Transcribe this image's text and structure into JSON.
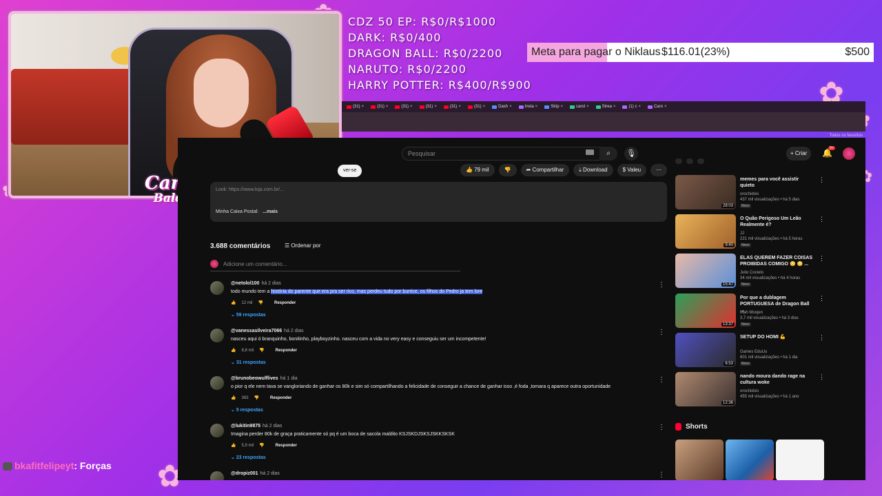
{
  "goals": {
    "lines": [
      "CDZ 50 EP: R$0/R$1000",
      "DARK: R$0/400",
      "DRAGON BALL: R$0/2200",
      "NARUTO: R$0/2200",
      "HARRY POTTER: R$400/R$900"
    ],
    "bar": {
      "title": "Meta para pagar o Niklaus",
      "current": "$116.01(23%)",
      "target": "$500",
      "progress": 0.23
    }
  },
  "stream": {
    "logo_line1": "Carol",
    "logo_line2": "Balds"
  },
  "browser": {
    "tabs": [
      {
        "label": "(31)",
        "icon": "youtube-icon"
      },
      {
        "label": "(31)",
        "icon": "youtube-icon"
      },
      {
        "label": "(31)",
        "icon": "youtube-icon"
      },
      {
        "label": "(31)",
        "icon": "youtube-icon"
      },
      {
        "label": "(31)",
        "icon": "youtube-icon"
      },
      {
        "label": "(31)",
        "icon": "youtube-icon"
      },
      {
        "label": "Dash",
        "icon": "dashboard-icon"
      },
      {
        "label": "Insta",
        "icon": "instagram-icon"
      },
      {
        "label": "Strip",
        "icon": "stripe-icon"
      },
      {
        "label": "carol",
        "icon": "kick-icon"
      },
      {
        "label": "Strea",
        "icon": "kick-icon"
      },
      {
        "label": "(1) c",
        "icon": "tab-icon"
      },
      {
        "label": "Caro",
        "icon": "tab-icon"
      }
    ],
    "bookmark_label": "Todos os favoritos"
  },
  "youtube": {
    "search_placeholder": "Pesquisar",
    "create_label": "Criar",
    "notification_count": "9+",
    "subscribe_label": "ver-se",
    "actions": {
      "likes": "79 mil",
      "share": "Compartilhar",
      "download": "Download",
      "thanks": "Valeu"
    },
    "description": {
      "line1": "Look: https://www.loja.com.br/...",
      "line2": "Minha Caixa Postal:",
      "more": "...mais"
    },
    "comments_header": {
      "count": "3.688 comentários",
      "sort": "Ordenar por",
      "add_placeholder": "Adicione um comentário..."
    },
    "comments": [
      {
        "author": "@netolol100",
        "age": "há 2 dias",
        "text_plain": "todo mundo tem a ",
        "text_highlight": "história do parente que era pra ser rico, mas perdeu tudo por burrice, os filhos do Pedro ja tem lore",
        "likes": "12 mil",
        "reply": "Responder",
        "replies": "59 respostas"
      },
      {
        "author": "@vanessasilveira7066",
        "age": "há 2 dias",
        "text_plain": "nasceu aqui ó branquinho, bonitinho, playboyzinho. nasceu com a vida no very easy e conseguiu ser um incompetente!",
        "text_highlight": "",
        "likes": "8,8 mil",
        "reply": "Responder",
        "replies": "31 respostas"
      },
      {
        "author": "@brunobeowulflives",
        "age": "há 1 dia",
        "text_plain": "o pior q ele nem tava se vangloriando de ganhar os 80k e sim só compartilhando a felicidade de conseguir a chance de ganhar isso ,é foda ,tomara q aparece outra oportunidade",
        "text_highlight": "",
        "likes": "363",
        "reply": "Responder",
        "replies": "5 respostas"
      },
      {
        "author": "@lukitin9875",
        "age": "há 2 dias",
        "text_plain": "Imagina perder 80k de graça praticamente só pq é um boca de sacola maldito KSJSKDJSKSJSKKSKSK",
        "text_highlight": "",
        "likes": "5,9 mil",
        "reply": "Responder",
        "replies": "23 respostas"
      },
      {
        "author": "@dropiz001",
        "age": "há 2 dias",
        "text_plain": "",
        "text_highlight": "",
        "likes": "",
        "reply": "",
        "replies": ""
      }
    ],
    "recommendations": [
      {
        "title": "memes para você assistir quieto",
        "channel": "orochidois",
        "views": "437 mil visualizações • há 5 dias",
        "duration": "28:03",
        "badge": "Novo"
      },
      {
        "title": "O Quão Perigoso Um Leão Realmente é?",
        "channel": "JJ",
        "views": "221 mil visualizações • há 5 horas",
        "duration": "9:40",
        "badge": "Novo"
      },
      {
        "title": "ELAS QUEREM FAZER COISAS PROIBIDAS COMIGO 😳 😳 ...",
        "channel": "Julio Cocielo",
        "views": "34 mil visualizações • há 4 horas",
        "duration": "15:47",
        "badge": "Novo"
      },
      {
        "title": "Por que a dublagem PORTUGUESA de Dragon Ball ...",
        "channel": "Mah Moojen",
        "views": "3,7 mil visualizações • há 3 dias",
        "duration": "13:37",
        "badge": "Novo"
      },
      {
        "title": "SETUP DO HOMI 💪",
        "channel": "Games EduUu",
        "views": "601 mil visualizações • há 1 dia",
        "duration": "6:53",
        "badge": "Novo"
      },
      {
        "title": "nando moura dando rage na cultura woke",
        "channel": "orochidois",
        "views": "455 mil visualizações • há 1 ano",
        "duration": "12:36",
        "badge": ""
      }
    ],
    "shorts_label": "Shorts"
  },
  "chat": {
    "user": "bkafitfelipeyt",
    "message": ": Forças"
  },
  "colors": {
    "accent_pink": "#f5a6df",
    "youtube_bg": "#0f0f0f",
    "highlight": "#3f5fd2",
    "link_blue": "#3ea6ff"
  }
}
